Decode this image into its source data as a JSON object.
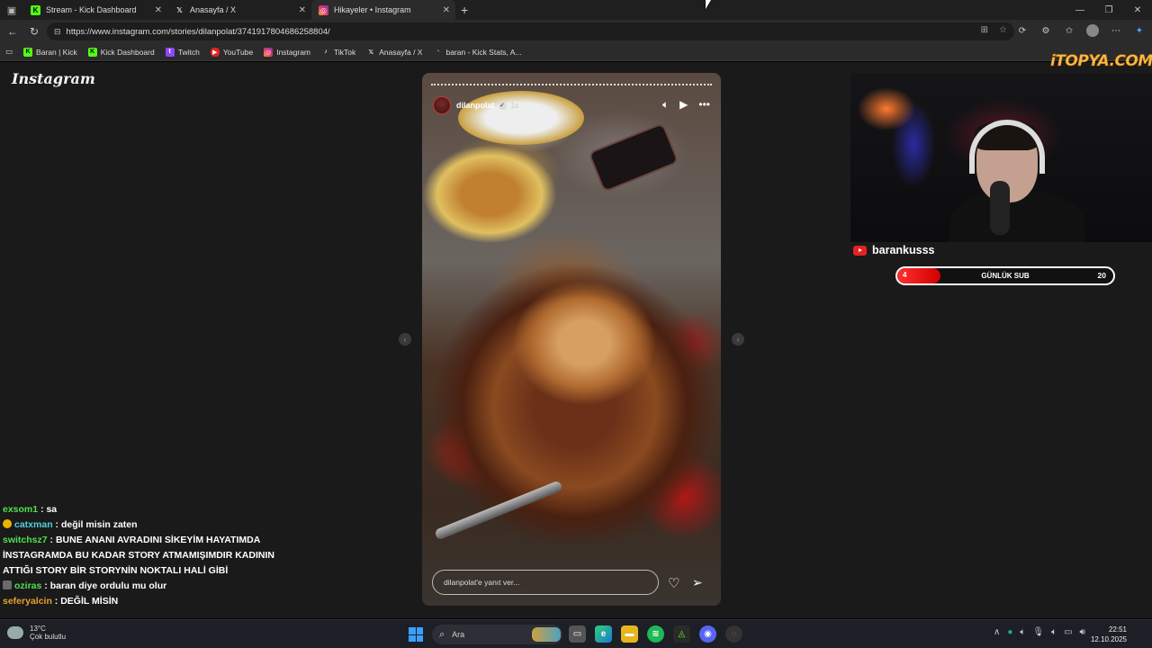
{
  "browser": {
    "tabs": [
      {
        "title": "Stream - Kick Dashboard",
        "icon": "kick-icon",
        "active": false
      },
      {
        "title": "Anasayfa / X",
        "icon": "x-icon",
        "active": false
      },
      {
        "title": "Hikayeler • Instagram",
        "icon": "instagram-icon",
        "active": true
      }
    ],
    "url": "https://www.instagram.com/stories/dilanpolat/3741917804686258804/",
    "bookmarks": [
      {
        "label": "Baran | Kick",
        "icon": "kick-icon"
      },
      {
        "label": "Kick Dashboard",
        "icon": "kick-icon"
      },
      {
        "label": "Twitch",
        "icon": "twitch-icon"
      },
      {
        "label": "YouTube",
        "icon": "youtube-icon"
      },
      {
        "label": "Instagram",
        "icon": "instagram-icon"
      },
      {
        "label": "TikTok",
        "icon": "tiktok-icon"
      },
      {
        "label": "Anasayfa / X",
        "icon": "x-icon"
      },
      {
        "label": "baran - Kick Stats, A...",
        "icon": "stats-icon"
      }
    ]
  },
  "instagram": {
    "logo": "Instagram",
    "story": {
      "username": "dilanpolat",
      "time": "1s",
      "reply_placeholder": "dilanpolat'e yanıt ver..."
    }
  },
  "stream": {
    "sponsor": "iTOPYA.COM",
    "channel": "barankusss",
    "sub_goal": {
      "label": "GÜNLÜK SUB",
      "current": "4",
      "goal": "20",
      "progress": 0.2
    }
  },
  "chat": [
    {
      "user": "exsom1",
      "color": "#4fe04f",
      "message": "sa",
      "badge": ""
    },
    {
      "user": "catxman",
      "color": "#4fd0e0",
      "message": "değil misin zaten",
      "badge": "gold"
    },
    {
      "user": "switchsz7",
      "color": "#4fe04f",
      "message": "BUNE ANANI AVRADINI SİKEYİM HAYATIMDA İNSTAGRAMDA BU KADAR STORY ATMAMIŞIMDIR KADININ ATTIĞI STORY BİR STORYNİN NOKTALI HALİ GİBİ",
      "badge": ""
    },
    {
      "user": "oziras",
      "color": "#4fe04f",
      "message": "baran diye ordulu mu olur",
      "badge": "square"
    },
    {
      "user": "seferyalcin",
      "color": "#e8a030",
      "message": "DEĞİL MİSİN",
      "badge": ""
    }
  ],
  "taskbar": {
    "weather_temp": "13°C",
    "weather_desc": "Çok bulutlu",
    "search_placeholder": "Ara",
    "time": "22:51",
    "date": "12.10.2025"
  },
  "colors": {
    "accent_red": "#e52222",
    "chat_green": "#4fe04f"
  }
}
